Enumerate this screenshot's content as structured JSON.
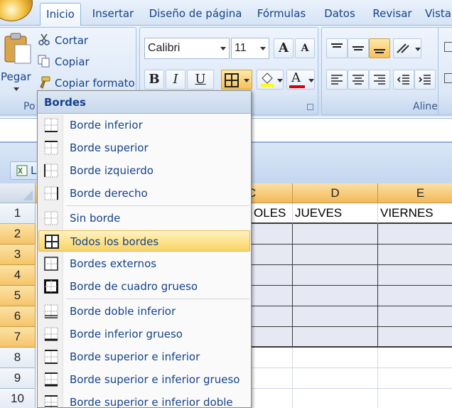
{
  "ribbon": {
    "tabs": [
      "Inicio",
      "Insertar",
      "Diseño de página",
      "Fórmulas",
      "Datos",
      "Revisar",
      "Vista"
    ],
    "active_tab": "Inicio",
    "clipboard": {
      "paste_label": "Pegar",
      "cut_label": "Cortar",
      "copy_label": "Copiar",
      "format_painter_label": "Copiar formato",
      "group_label": "Po"
    },
    "font": {
      "font_name": "Calibri",
      "font_size": "11",
      "bold_label": "B",
      "italic_label": "I",
      "underline_label": "U",
      "font_color_label": "A",
      "increase_label": "A",
      "decrease_label": "A"
    },
    "alignment": {
      "group_label": "Alineaci"
    }
  },
  "workbook": {
    "title_prefix": "L"
  },
  "sheet": {
    "columns": [
      "C",
      "D",
      "E"
    ],
    "rows": [
      "1",
      "2",
      "3",
      "4",
      "5",
      "6",
      "7",
      "8",
      "9",
      "10"
    ],
    "row1_cells": [
      "OLES",
      "JUEVES",
      "VIERNES"
    ]
  },
  "menu": {
    "title": "Bordes",
    "highlighted_item": "Todos los bordes",
    "items": [
      "Borde inferior",
      "Borde superior",
      "Borde izquierdo",
      "Borde derecho",
      "Sin borde",
      "Todos los bordes",
      "Bordes externos",
      "Borde de cuadro grueso",
      "Borde doble inferior",
      "Borde inferior grueso",
      "Borde superior e inferior",
      "Borde superior e inferior grueso",
      "Borde superior e inferior doble"
    ]
  },
  "colors": {
    "ribbon_text": "#15428b",
    "selection_orange": "#f6c46a",
    "menu_highlight": "#fde28a",
    "font_color_red": "#e00000",
    "fill_color_yellow": "#ffff00"
  }
}
